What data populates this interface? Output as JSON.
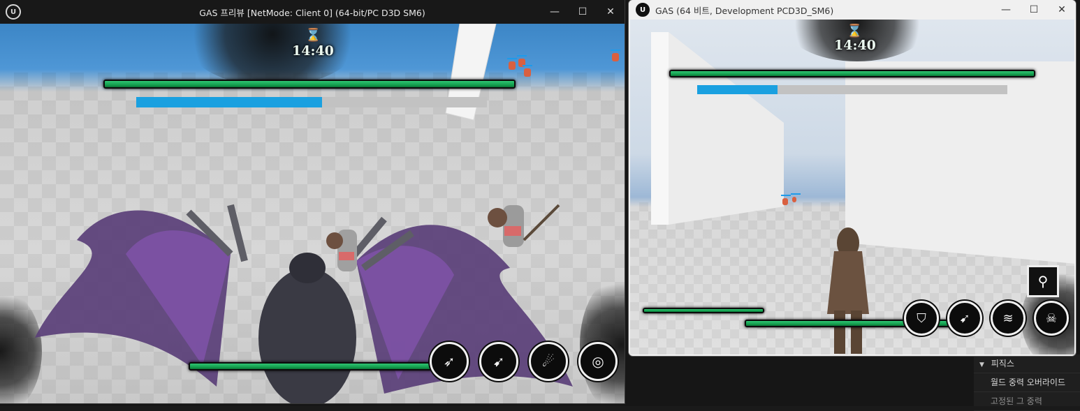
{
  "window1": {
    "title": "GAS 프리뷰 [NetMode: Client 0]  (64-bit/PC D3D SM6)",
    "logo": "ue-logo",
    "controls": {
      "minimize": "—",
      "maximize": "☐",
      "close": "✕"
    },
    "hud": {
      "timer": "14:40",
      "timer_icon": "hourglass-icon",
      "mana_fraction": 0.53,
      "skills": [
        {
          "icon": "dash-icon",
          "glyph": "➶"
        },
        {
          "icon": "feather-strike-icon",
          "glyph": "➹"
        },
        {
          "icon": "fireball-icon",
          "glyph": "☄"
        },
        {
          "icon": "vortex-icon",
          "glyph": "◎"
        }
      ]
    }
  },
  "window2": {
    "title": "GAS (64 비트, Development PCD3D_SM6)",
    "logo": "ue-logo",
    "controls": {
      "minimize": "—",
      "maximize": "☐",
      "close": "✕"
    },
    "hud": {
      "timer": "14:40",
      "timer_icon": "hourglass-icon",
      "mana_fraction": 0.26,
      "skills": [
        {
          "icon": "shield-icon",
          "glyph": "⛉"
        },
        {
          "icon": "arrow-volley-icon",
          "glyph": "➹"
        },
        {
          "icon": "claw-slash-icon",
          "glyph": "≋"
        },
        {
          "icon": "skull-orb-icon",
          "glyph": "☠"
        }
      ],
      "square_skill": {
        "icon": "staff-icon",
        "glyph": "⚲"
      }
    }
  },
  "details_panel": {
    "items": [
      "피직스",
      "월드 중력 오버라이드",
      "고정된 그 중력"
    ]
  },
  "colors": {
    "health_green": "#17a650",
    "mana_blue": "#1aa0e0",
    "track_grey": "#c2c2c2",
    "timer_green": "#39c08a"
  }
}
